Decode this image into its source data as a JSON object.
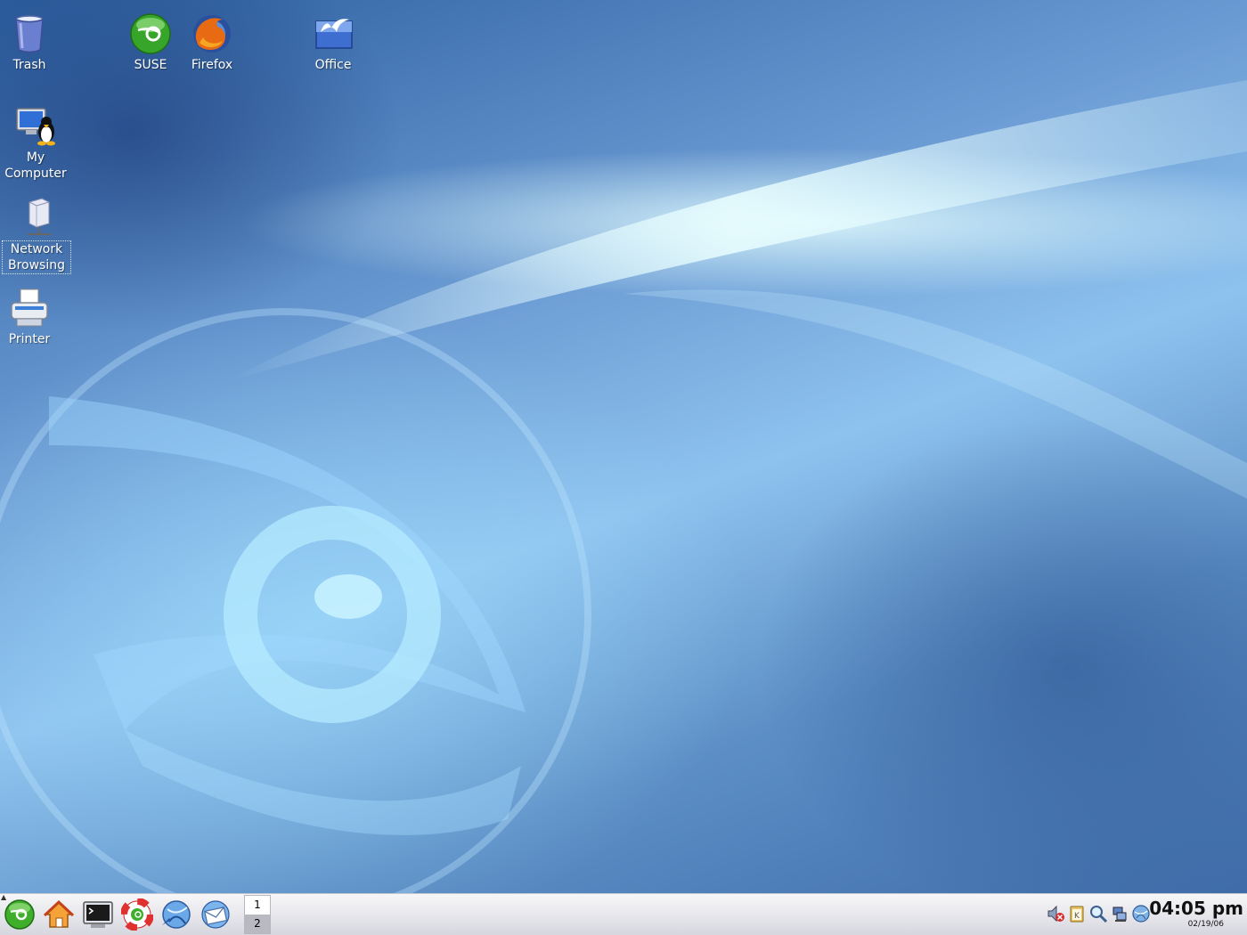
{
  "desktop": {
    "icons": [
      {
        "label": "Trash",
        "icon": "trash-icon"
      },
      {
        "label": "SUSE",
        "icon": "suse-icon"
      },
      {
        "label": "Firefox",
        "icon": "firefox-icon"
      },
      {
        "label": "Office",
        "icon": "office-icon"
      },
      {
        "label": "My\nComputer",
        "icon": "my-computer-icon"
      },
      {
        "label": "Network\nBrowsing",
        "icon": "network-browsing-icon"
      },
      {
        "label": "Printer",
        "icon": "printer-icon"
      }
    ]
  },
  "taskbar": {
    "launchers": [
      {
        "icon": "suse-menu-icon"
      },
      {
        "icon": "home-folder-icon"
      },
      {
        "icon": "terminal-icon"
      },
      {
        "icon": "help-lifebuoy-icon"
      },
      {
        "icon": "konqueror-browser-icon"
      },
      {
        "icon": "mail-client-icon"
      }
    ],
    "pager": {
      "desktops": [
        "1",
        "2"
      ],
      "active": "1"
    },
    "tray": [
      {
        "icon": "volume-muted-icon"
      },
      {
        "icon": "klipper-clipboard-icon"
      },
      {
        "icon": "search-magnifier-icon"
      },
      {
        "icon": "network-devices-icon"
      },
      {
        "icon": "update-globe-icon"
      }
    ],
    "clock": {
      "time": "04:05 pm",
      "date": "02/19/06"
    }
  },
  "colors": {
    "desktop_blue": "#6b9bd3",
    "taskbar_bg": "#e4e4ea",
    "suse_green": "#3fae2a"
  }
}
